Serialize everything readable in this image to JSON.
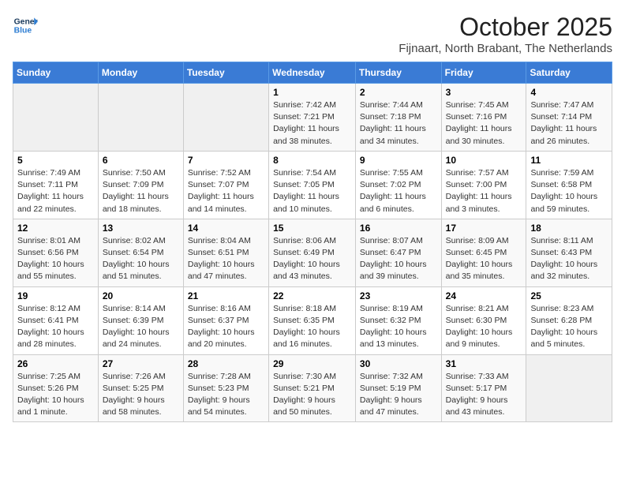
{
  "logo": {
    "line1": "General",
    "line2": "Blue"
  },
  "title": "October 2025",
  "subtitle": "Fijnaart, North Brabant, The Netherlands",
  "weekdays": [
    "Sunday",
    "Monday",
    "Tuesday",
    "Wednesday",
    "Thursday",
    "Friday",
    "Saturday"
  ],
  "weeks": [
    [
      {
        "day": "",
        "info": ""
      },
      {
        "day": "",
        "info": ""
      },
      {
        "day": "",
        "info": ""
      },
      {
        "day": "1",
        "info": "Sunrise: 7:42 AM\nSunset: 7:21 PM\nDaylight: 11 hours\nand 38 minutes."
      },
      {
        "day": "2",
        "info": "Sunrise: 7:44 AM\nSunset: 7:18 PM\nDaylight: 11 hours\nand 34 minutes."
      },
      {
        "day": "3",
        "info": "Sunrise: 7:45 AM\nSunset: 7:16 PM\nDaylight: 11 hours\nand 30 minutes."
      },
      {
        "day": "4",
        "info": "Sunrise: 7:47 AM\nSunset: 7:14 PM\nDaylight: 11 hours\nand 26 minutes."
      }
    ],
    [
      {
        "day": "5",
        "info": "Sunrise: 7:49 AM\nSunset: 7:11 PM\nDaylight: 11 hours\nand 22 minutes."
      },
      {
        "day": "6",
        "info": "Sunrise: 7:50 AM\nSunset: 7:09 PM\nDaylight: 11 hours\nand 18 minutes."
      },
      {
        "day": "7",
        "info": "Sunrise: 7:52 AM\nSunset: 7:07 PM\nDaylight: 11 hours\nand 14 minutes."
      },
      {
        "day": "8",
        "info": "Sunrise: 7:54 AM\nSunset: 7:05 PM\nDaylight: 11 hours\nand 10 minutes."
      },
      {
        "day": "9",
        "info": "Sunrise: 7:55 AM\nSunset: 7:02 PM\nDaylight: 11 hours\nand 6 minutes."
      },
      {
        "day": "10",
        "info": "Sunrise: 7:57 AM\nSunset: 7:00 PM\nDaylight: 11 hours\nand 3 minutes."
      },
      {
        "day": "11",
        "info": "Sunrise: 7:59 AM\nSunset: 6:58 PM\nDaylight: 10 hours\nand 59 minutes."
      }
    ],
    [
      {
        "day": "12",
        "info": "Sunrise: 8:01 AM\nSunset: 6:56 PM\nDaylight: 10 hours\nand 55 minutes."
      },
      {
        "day": "13",
        "info": "Sunrise: 8:02 AM\nSunset: 6:54 PM\nDaylight: 10 hours\nand 51 minutes."
      },
      {
        "day": "14",
        "info": "Sunrise: 8:04 AM\nSunset: 6:51 PM\nDaylight: 10 hours\nand 47 minutes."
      },
      {
        "day": "15",
        "info": "Sunrise: 8:06 AM\nSunset: 6:49 PM\nDaylight: 10 hours\nand 43 minutes."
      },
      {
        "day": "16",
        "info": "Sunrise: 8:07 AM\nSunset: 6:47 PM\nDaylight: 10 hours\nand 39 minutes."
      },
      {
        "day": "17",
        "info": "Sunrise: 8:09 AM\nSunset: 6:45 PM\nDaylight: 10 hours\nand 35 minutes."
      },
      {
        "day": "18",
        "info": "Sunrise: 8:11 AM\nSunset: 6:43 PM\nDaylight: 10 hours\nand 32 minutes."
      }
    ],
    [
      {
        "day": "19",
        "info": "Sunrise: 8:12 AM\nSunset: 6:41 PM\nDaylight: 10 hours\nand 28 minutes."
      },
      {
        "day": "20",
        "info": "Sunrise: 8:14 AM\nSunset: 6:39 PM\nDaylight: 10 hours\nand 24 minutes."
      },
      {
        "day": "21",
        "info": "Sunrise: 8:16 AM\nSunset: 6:37 PM\nDaylight: 10 hours\nand 20 minutes."
      },
      {
        "day": "22",
        "info": "Sunrise: 8:18 AM\nSunset: 6:35 PM\nDaylight: 10 hours\nand 16 minutes."
      },
      {
        "day": "23",
        "info": "Sunrise: 8:19 AM\nSunset: 6:32 PM\nDaylight: 10 hours\nand 13 minutes."
      },
      {
        "day": "24",
        "info": "Sunrise: 8:21 AM\nSunset: 6:30 PM\nDaylight: 10 hours\nand 9 minutes."
      },
      {
        "day": "25",
        "info": "Sunrise: 8:23 AM\nSunset: 6:28 PM\nDaylight: 10 hours\nand 5 minutes."
      }
    ],
    [
      {
        "day": "26",
        "info": "Sunrise: 7:25 AM\nSunset: 5:26 PM\nDaylight: 10 hours\nand 1 minute."
      },
      {
        "day": "27",
        "info": "Sunrise: 7:26 AM\nSunset: 5:25 PM\nDaylight: 9 hours\nand 58 minutes."
      },
      {
        "day": "28",
        "info": "Sunrise: 7:28 AM\nSunset: 5:23 PM\nDaylight: 9 hours\nand 54 minutes."
      },
      {
        "day": "29",
        "info": "Sunrise: 7:30 AM\nSunset: 5:21 PM\nDaylight: 9 hours\nand 50 minutes."
      },
      {
        "day": "30",
        "info": "Sunrise: 7:32 AM\nSunset: 5:19 PM\nDaylight: 9 hours\nand 47 minutes."
      },
      {
        "day": "31",
        "info": "Sunrise: 7:33 AM\nSunset: 5:17 PM\nDaylight: 9 hours\nand 43 minutes."
      },
      {
        "day": "",
        "info": ""
      }
    ]
  ]
}
